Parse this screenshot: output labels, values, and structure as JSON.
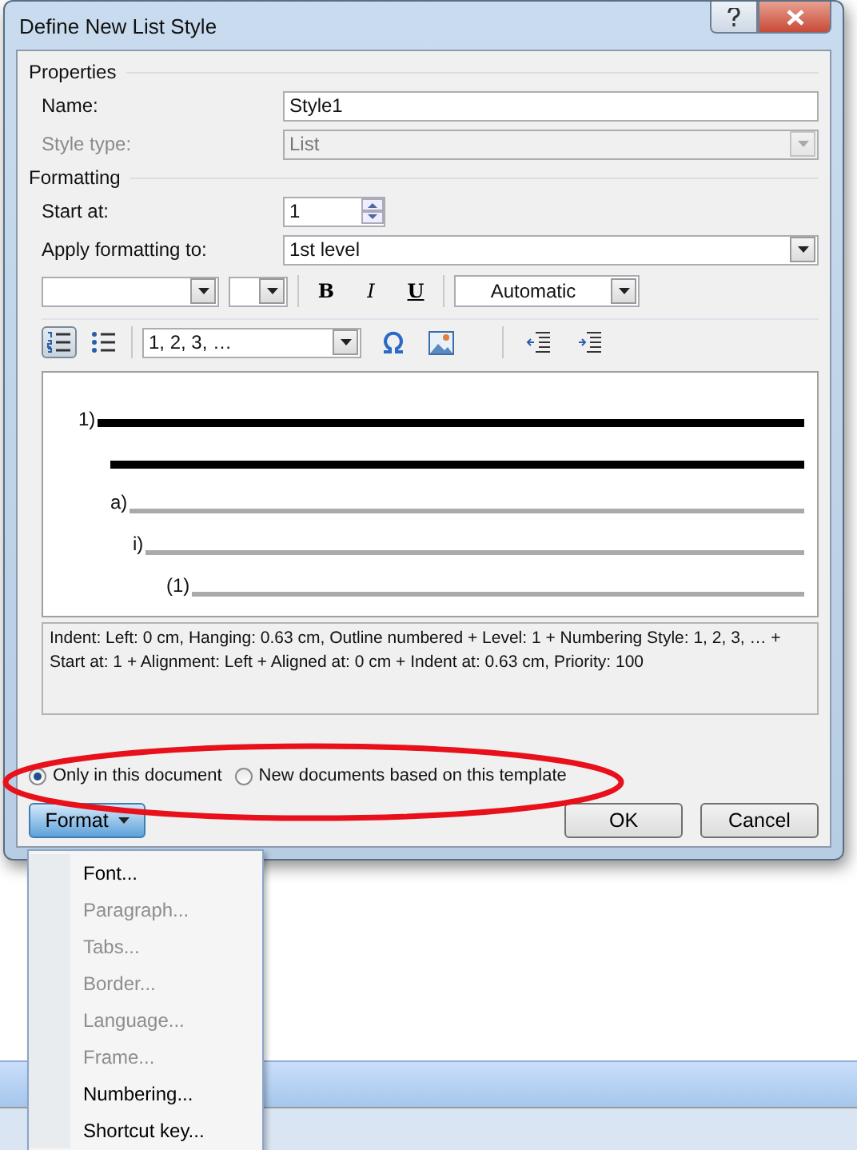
{
  "window": {
    "title": "Define New List Style"
  },
  "properties": {
    "heading": "Properties",
    "name": {
      "label": "Name:",
      "value": "Style1"
    },
    "style_type": {
      "label": "Style type:",
      "value": "List",
      "disabled": true
    }
  },
  "formatting": {
    "heading": "Formatting",
    "start_at": {
      "label": "Start at:",
      "value": "1"
    },
    "apply_to": {
      "label": "Apply formatting to:",
      "value": "1st level"
    }
  },
  "font_toolbar": {
    "bold": "B",
    "italic": "I",
    "underline": "U",
    "font_color_label": "Automatic"
  },
  "numbering_toolbar": {
    "numbered_selected": true,
    "bulleted_selected": false,
    "style": "1, 2, 3, …"
  },
  "preview": {
    "levels": [
      {
        "marker": "1)",
        "selected": true,
        "wrapped": true,
        "children": [
          {
            "marker": "a)",
            "selected": false,
            "wrapped": false,
            "children": [
              {
                "marker": "i)",
                "selected": false,
                "wrapped": false,
                "children": [
                  {
                    "marker": "(1)",
                    "selected": false,
                    "wrapped": false
                  }
                ]
              }
            ]
          }
        ]
      }
    ]
  },
  "description": "Indent: Left:  0 cm, Hanging:  0.63 cm, Outline numbered + Level: 1 + Numbering Style: 1, 2, 3, … + Start at: 1 + Alignment: Left + Aligned at:  0 cm + Indent at:  0.63 cm, Priority: 100",
  "scope": [
    {
      "label": "Only in this document",
      "selected": true
    },
    {
      "label": "New documents based on this template",
      "selected": false
    }
  ],
  "buttons": {
    "format": "Format",
    "ok": "OK",
    "cancel": "Cancel"
  },
  "format_menu": [
    {
      "label": "Font...",
      "disabled": false
    },
    {
      "label": "Paragraph...",
      "disabled": true
    },
    {
      "label": "Tabs...",
      "disabled": true
    },
    {
      "label": "Border...",
      "disabled": true
    },
    {
      "label": "Language...",
      "disabled": true
    },
    {
      "label": "Frame...",
      "disabled": true
    },
    {
      "label": "Numbering...",
      "disabled": false
    },
    {
      "label": "Shortcut key...",
      "disabled": false
    }
  ]
}
